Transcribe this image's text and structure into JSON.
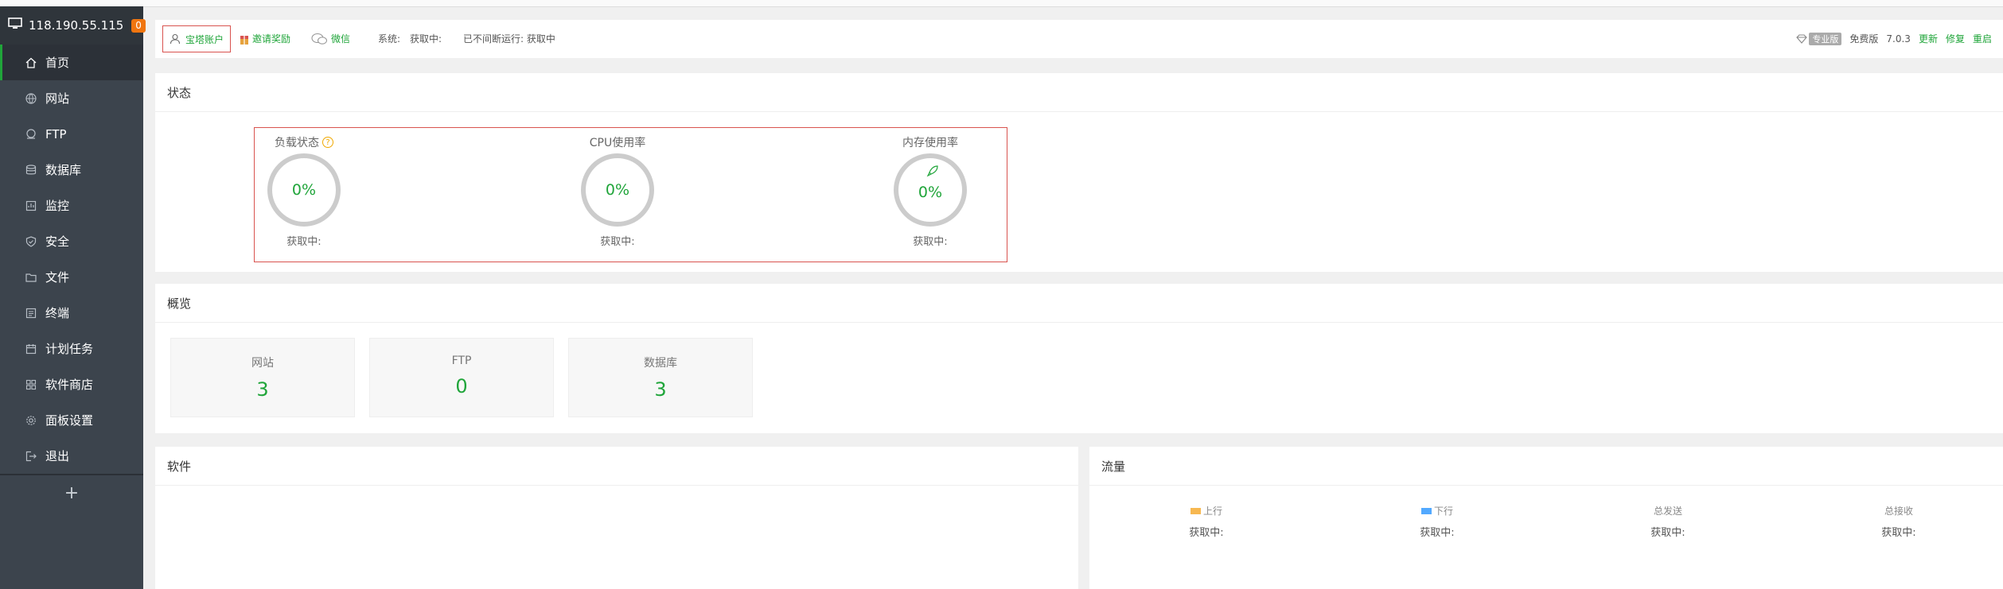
{
  "sidebar": {
    "ip": "118.190.55.115",
    "badge": "0",
    "items": [
      {
        "label": "首页",
        "icon": "home-icon"
      },
      {
        "label": "网站",
        "icon": "globe-icon"
      },
      {
        "label": "FTP",
        "icon": "ftp-icon"
      },
      {
        "label": "数据库",
        "icon": "database-icon"
      },
      {
        "label": "监控",
        "icon": "monitor-icon"
      },
      {
        "label": "安全",
        "icon": "shield-icon"
      },
      {
        "label": "文件",
        "icon": "folder-icon"
      },
      {
        "label": "终端",
        "icon": "terminal-icon"
      },
      {
        "label": "计划任务",
        "icon": "calendar-icon"
      },
      {
        "label": "软件商店",
        "icon": "apps-icon"
      },
      {
        "label": "面板设置",
        "icon": "gear-icon"
      },
      {
        "label": "退出",
        "icon": "logout-icon"
      }
    ],
    "add": "+"
  },
  "topbar": {
    "account": "宝塔账户",
    "invite": "邀请奖励",
    "wechat": "微信",
    "system_label": "系统:",
    "system_value": "获取中:",
    "uptime": "已不间断运行: 获取中",
    "pro_tag": "专业版",
    "edition": "免费版",
    "version": "7.0.3",
    "update": "更新",
    "repair": "修复",
    "restart": "重启"
  },
  "status": {
    "title": "状态",
    "gauges": [
      {
        "label": "负载状态",
        "value": "0%",
        "sub": "获取中:"
      },
      {
        "label": "CPU使用率",
        "value": "0%",
        "sub": "获取中:"
      },
      {
        "label": "内存使用率",
        "value": "0%",
        "sub": "获取中:"
      }
    ]
  },
  "overview": {
    "title": "概览",
    "cards": [
      {
        "label": "网站",
        "value": "3"
      },
      {
        "label": "FTP",
        "value": "0"
      },
      {
        "label": "数据库",
        "value": "3"
      }
    ]
  },
  "software": {
    "title": "软件"
  },
  "traffic": {
    "title": "流量",
    "columns": [
      {
        "label": "上行",
        "value": "获取中:",
        "color": "#f7b851"
      },
      {
        "label": "下行",
        "value": "获取中:",
        "color": "#52a9ff"
      },
      {
        "label": "总发送",
        "value": "获取中:"
      },
      {
        "label": "总接收",
        "value": "获取中:"
      }
    ]
  },
  "colors": {
    "accent": "#20a53a",
    "sidebar": "#3c444d",
    "highlight_border": "#d9534f",
    "badge": "#f0750f"
  }
}
